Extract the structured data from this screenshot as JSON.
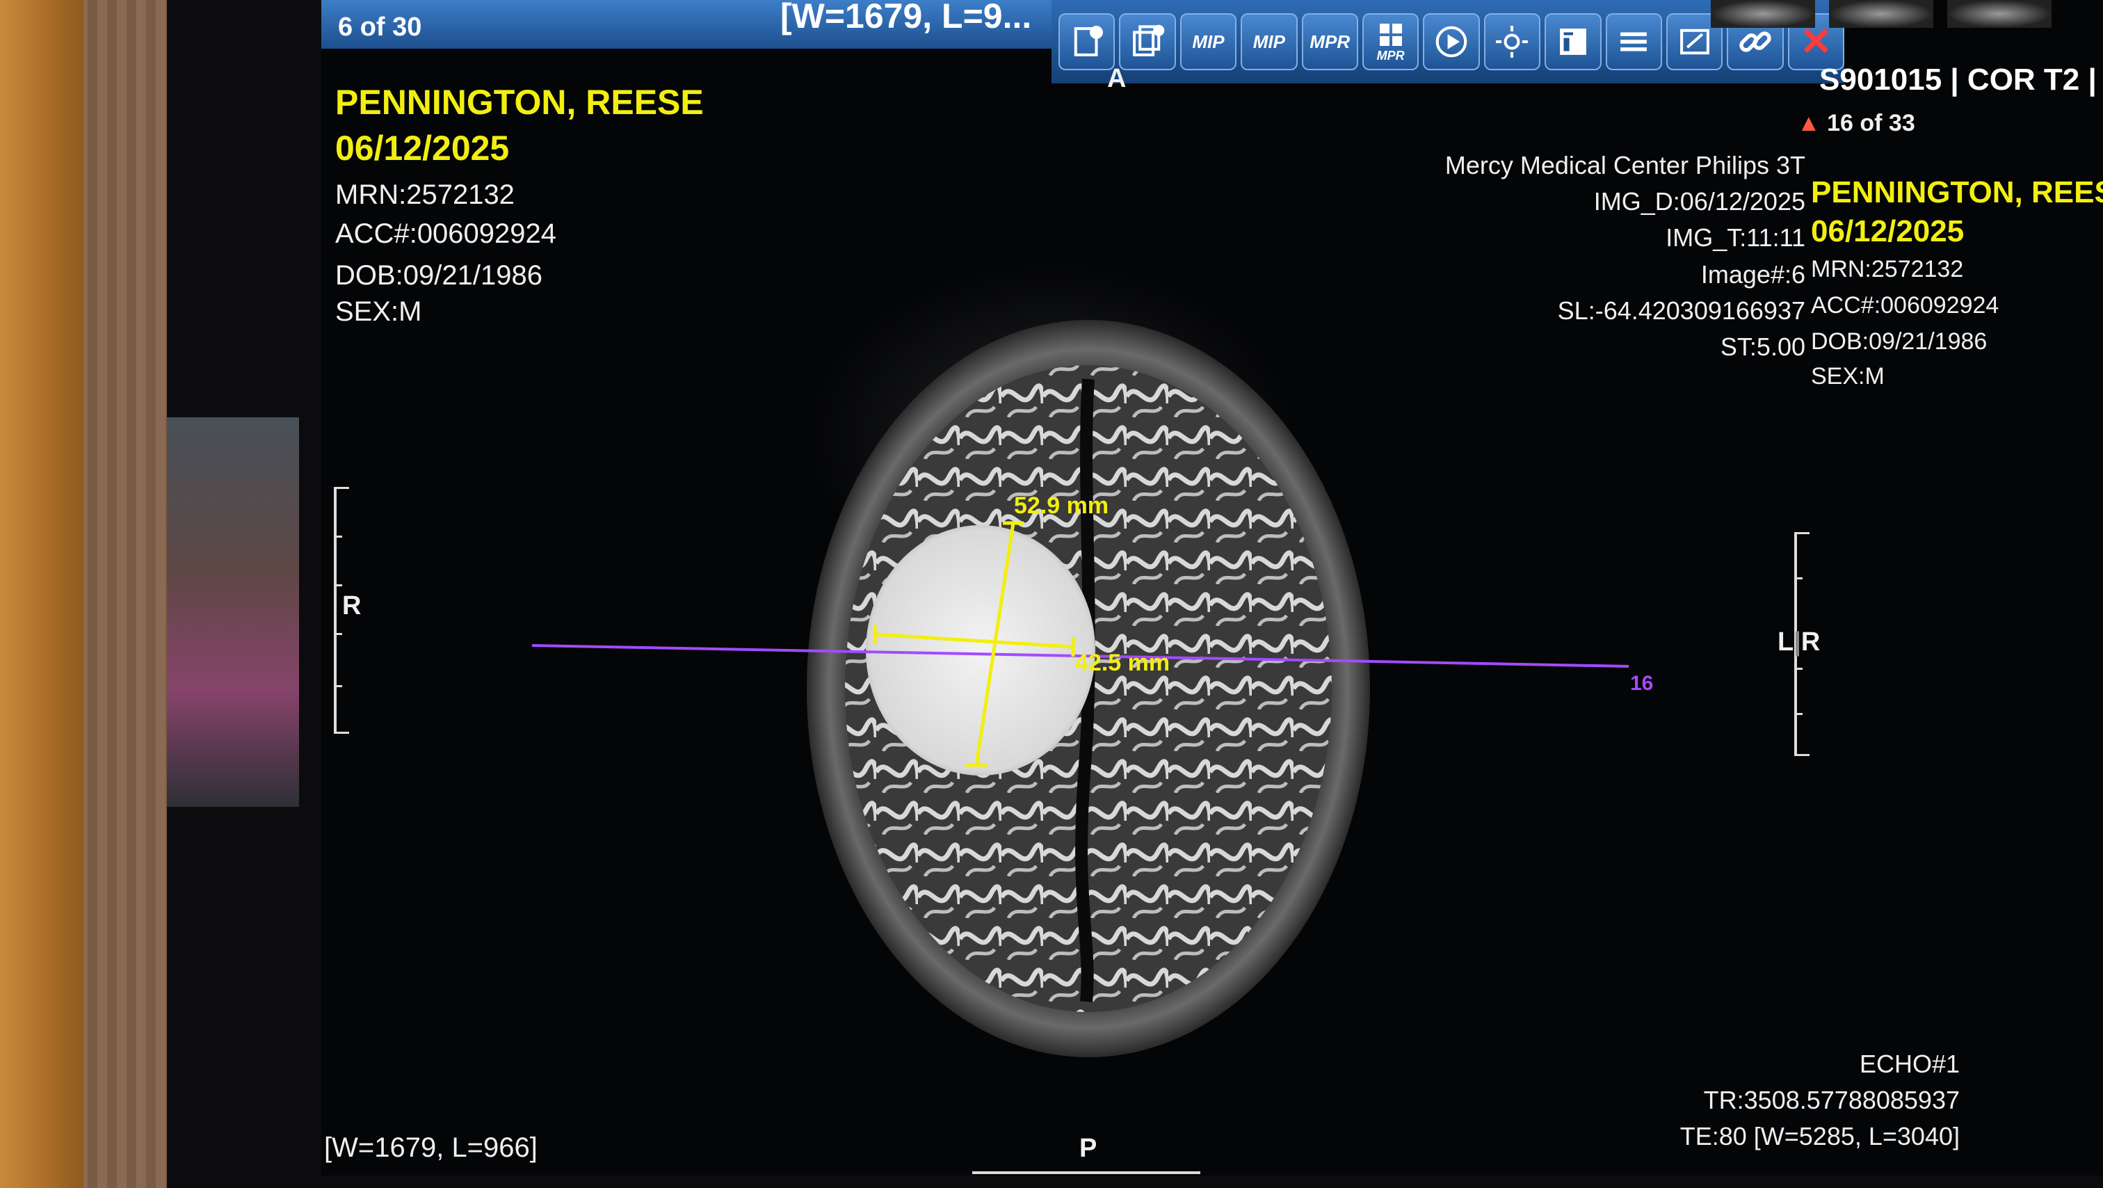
{
  "viewer": {
    "title_counter": "6 of 30",
    "title_wl_fragment": "[W=1679, L=9...",
    "series_label": "S901015 | COR T2 |",
    "toolbar": [
      {
        "name": "dicom-info-icon",
        "label": ""
      },
      {
        "name": "series-info-icon",
        "label": ""
      },
      {
        "name": "mip-button",
        "label": "MIP"
      },
      {
        "name": "mip-rotate-button",
        "label": "MIP"
      },
      {
        "name": "mpr-button",
        "label": "MPR"
      },
      {
        "name": "mpr-grid-button",
        "label": "MPR"
      },
      {
        "name": "cine-play-icon",
        "label": ""
      },
      {
        "name": "brightness-icon",
        "label": ""
      },
      {
        "name": "report-icon",
        "label": ""
      },
      {
        "name": "stack-icon",
        "label": ""
      },
      {
        "name": "annotation-icon",
        "label": ""
      },
      {
        "name": "link-icon",
        "label": ""
      },
      {
        "name": "close-icon",
        "label": "✕"
      }
    ]
  },
  "left_overlay": {
    "patient_name": "PENNINGTON, REESE",
    "study_date": "06/12/2025",
    "mrn": "MRN:2572132",
    "acc": "ACC#:006092924",
    "dob": "DOB:09/21/1986",
    "sex": "SEX:M",
    "window_level": "[W=1679, L=966]"
  },
  "orientation": {
    "top": "A",
    "bottom": "P",
    "left": "R",
    "right_l": "L",
    "right_r": "R"
  },
  "right_overlay": {
    "reference_counter": "16 of 33",
    "institution": "Mercy Medical Center Philips 3T",
    "img_date": "IMG_D:06/12/2025",
    "img_time": "IMG_T:11:11",
    "image_no": "Image#:6",
    "slice_location": "SL:-64.420309166937",
    "slice_thickness": "ST:5.00",
    "patient_name": "PENNINGTON, REESE",
    "study_date": "06/12/2025",
    "mrn": "MRN:2572132",
    "acc": "ACC#:006092924",
    "dob": "DOB:09/21/1986",
    "sex": "SEX:M",
    "echo": "ECHO#1",
    "tr": "TR:3508.57788085937",
    "te_wl": "TE:80 [W=5285, L=3040]"
  },
  "measurements": {
    "vertical": "52.9 mm",
    "horizontal": "42.5 mm",
    "reference_line_label": "16"
  },
  "colors": {
    "overlay_yellow": "#f2ef10",
    "reference_line": "#a34bff",
    "toolbar_blue": "#1e5496"
  }
}
